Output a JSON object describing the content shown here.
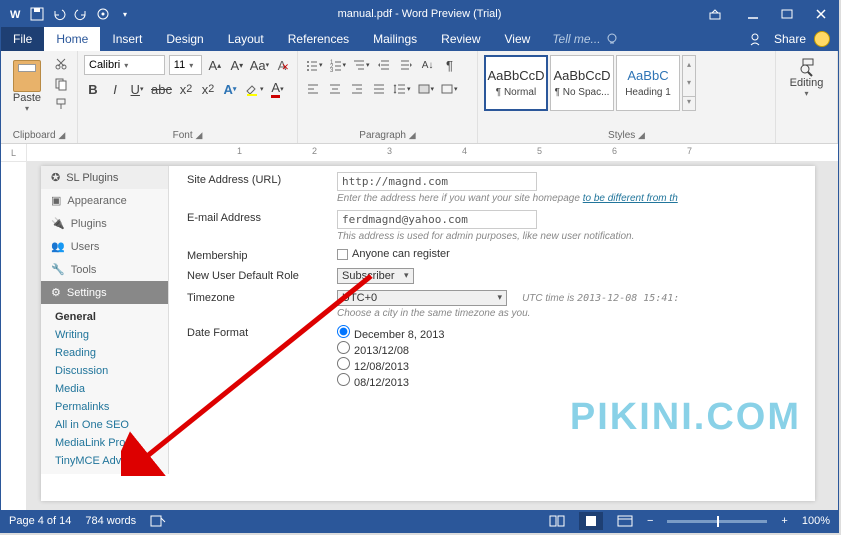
{
  "titlebar": {
    "title": "manual.pdf - Word Preview (Trial)"
  },
  "tabs": {
    "file": "File",
    "home": "Home",
    "insert": "Insert",
    "design": "Design",
    "layout": "Layout",
    "references": "References",
    "mailings": "Mailings",
    "review": "Review",
    "view": "View",
    "tellme": "Tell me...",
    "share": "Share"
  },
  "ribbon": {
    "clipboard": {
      "label": "Clipboard",
      "paste": "Paste"
    },
    "font": {
      "label": "Font",
      "name": "Calibri",
      "size": "11"
    },
    "paragraph": {
      "label": "Paragraph"
    },
    "styles": {
      "label": "Styles",
      "items": [
        {
          "sample": "AaBbCcD",
          "name": "¶ Normal"
        },
        {
          "sample": "AaBbCcD",
          "name": "¶ No Spac..."
        },
        {
          "sample": "AaBbC",
          "name": "Heading 1"
        }
      ]
    },
    "editing": {
      "label": "Editing"
    }
  },
  "document": {
    "sidebar": {
      "top": [
        {
          "icon": "plugins",
          "label": "SL Plugins"
        },
        {
          "icon": "appearance",
          "label": "Appearance"
        },
        {
          "icon": "plugin",
          "label": "Plugins"
        },
        {
          "icon": "users",
          "label": "Users"
        },
        {
          "icon": "tools",
          "label": "Tools"
        },
        {
          "icon": "settings",
          "label": "Settings"
        }
      ],
      "sub": [
        "General",
        "Writing",
        "Reading",
        "Discussion",
        "Media",
        "Permalinks",
        "All in One SEO",
        "MediaLink Pro",
        "TinyMCE Advanced"
      ]
    },
    "form": {
      "siteaddr_label": "Site Address (URL)",
      "siteaddr_value": "http://magnd.com",
      "siteaddr_hint1": "Enter the address here if you want your site homepage ",
      "siteaddr_hint2": "to be different from th",
      "email_label": "E-mail Address",
      "email_value": "ferdmagnd@yahoo.com",
      "email_hint": "This address is used for admin purposes, like new user notification.",
      "membership_label": "Membership",
      "membership_chk": "Anyone can register",
      "role_label": "New User Default Role",
      "role_value": "Subscriber",
      "tz_label": "Timezone",
      "tz_value": "UTC+0",
      "tz_hint_prefix": "UTC time is ",
      "tz_hint_value": "2013-12-08 15:41:",
      "tz_hint2": "Choose a city in the same timezone as you.",
      "df_label": "Date Format",
      "df_opts": [
        "December 8, 2013",
        "2013/12/08",
        "12/08/2013",
        "08/12/2013"
      ]
    },
    "watermark": "PIKINI.COM"
  },
  "statusbar": {
    "page": "Page 4 of 14",
    "words": "784 words",
    "zoom": "100%"
  }
}
